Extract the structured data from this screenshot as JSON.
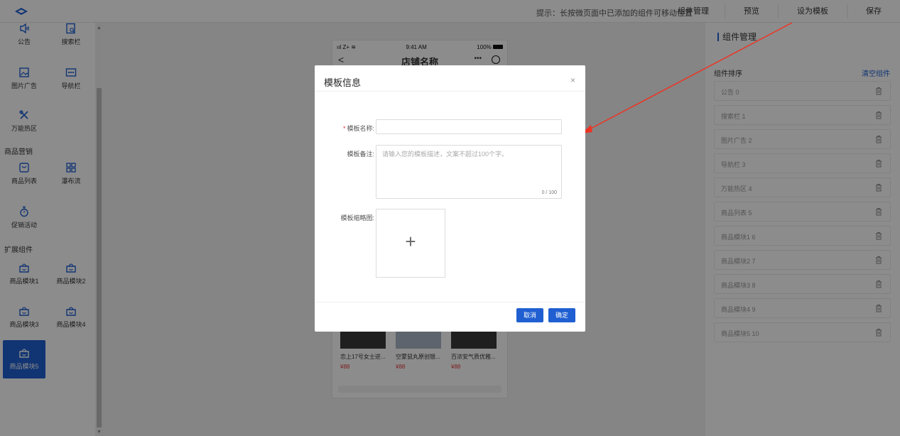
{
  "topbar": {
    "hint": "提示：长按微页面中已添加的组件可移动位置",
    "actions": [
      "组件管理",
      "预览",
      "设为模板",
      "保存"
    ],
    "logo_icon": "logo-icon"
  },
  "palette": {
    "basic": [
      {
        "label": "公告",
        "icon": "notice-icon"
      },
      {
        "label": "搜索栏",
        "icon": "search-bar-icon"
      },
      {
        "label": "图片广告",
        "icon": "image-ad-icon"
      },
      {
        "label": "导航栏",
        "icon": "nav-bar-icon"
      },
      {
        "label": "万能热区",
        "icon": "hotzone-icon"
      }
    ],
    "section_marketing": "商品营销",
    "marketing": [
      {
        "label": "商品列表",
        "icon": "product-list-icon"
      },
      {
        "label": "瀑布流",
        "icon": "waterfall-icon"
      },
      {
        "label": "促销活动",
        "icon": "promotion-icon"
      }
    ],
    "section_extend": "扩展组件",
    "extend": [
      {
        "label": "商品模块1",
        "icon": "basket-icon"
      },
      {
        "label": "商品模块2",
        "icon": "basket-icon"
      },
      {
        "label": "商品模块3",
        "icon": "basket-icon"
      },
      {
        "label": "商品模块4",
        "icon": "basket-icon"
      },
      {
        "label": "商品模块5",
        "icon": "basket-icon",
        "active": true
      }
    ]
  },
  "phone": {
    "signal": "ııl Z+ ≋",
    "time": "9:41 AM",
    "battery": "100%",
    "back": "<",
    "shop_name": "店铺名称",
    "products": [
      {
        "name": "恋上17号女士逆...",
        "price": "¥88"
      },
      {
        "name": "空蒙鼠丸原创银...",
        "price": "¥88"
      },
      {
        "name": "百浓安气质优雅...",
        "price": "¥88"
      }
    ]
  },
  "right": {
    "header": "组件管理",
    "sort_label": "组件排序",
    "clear_label": "清空组件",
    "items": [
      "公告 0",
      "搜索栏 1",
      "图片广告 2",
      "导航栏 3",
      "万能热区 4",
      "商品列表 5",
      "商品模块1 6",
      "商品模块2 7",
      "商品模块3 8",
      "商品模块4 9",
      "商品模块5 10"
    ]
  },
  "modal": {
    "title": "模板信息",
    "close": "×",
    "name_label": "模板名称:",
    "name_required": "*",
    "name_value": "",
    "desc_label": "模板备注:",
    "desc_placeholder": "请输入您的模板描述，文案不超过100个字。",
    "desc_count": "0 / 100",
    "thumb_label": "模板缩略图:",
    "upload_plus": "+",
    "cancel": "取消",
    "confirm": "确定"
  },
  "colors": {
    "accent": "#1f5fd1",
    "danger": "#e4393c",
    "arrow": "#ee3322"
  }
}
